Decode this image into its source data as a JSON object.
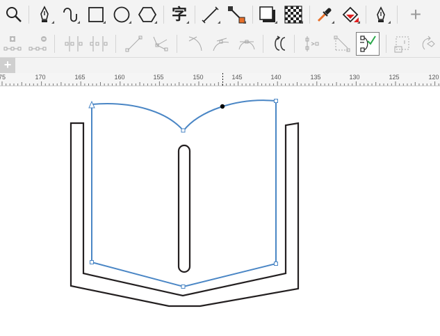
{
  "toolbar": {
    "tools": [
      {
        "name": "zoom-tool-icon"
      },
      {
        "name": "pen-tool-icon"
      },
      {
        "name": "spiro-tool-icon"
      },
      {
        "name": "rectangle-tool-icon"
      },
      {
        "name": "ellipse-tool-icon"
      },
      {
        "name": "polygon-tool-icon"
      },
      {
        "name": "text-tool-icon",
        "glyph": "字"
      },
      {
        "name": "line-tool-icon"
      },
      {
        "name": "connector-tool-icon"
      },
      {
        "name": "shadow-tool-icon"
      },
      {
        "name": "transparency-tool-icon"
      },
      {
        "name": "eyedropper-tool-icon"
      },
      {
        "name": "fill-tool-icon"
      },
      {
        "name": "pen-nib-tool-icon"
      },
      {
        "name": "add-tool-icon",
        "glyph": "+"
      }
    ]
  },
  "tabs": {
    "add_label": "+"
  },
  "ruler": {
    "labels": [
      "75",
      "170",
      "165",
      "160",
      "155",
      "150",
      "145",
      "140",
      "135",
      "130",
      "125",
      "120"
    ]
  },
  "colors": {
    "selection": "#4a86c5",
    "outline": "#231f20",
    "toolbar_bg": "#f3f3f3",
    "accent_orange": "#e8702a",
    "accent_red": "#e02020",
    "accent_green": "#2aa84a"
  }
}
